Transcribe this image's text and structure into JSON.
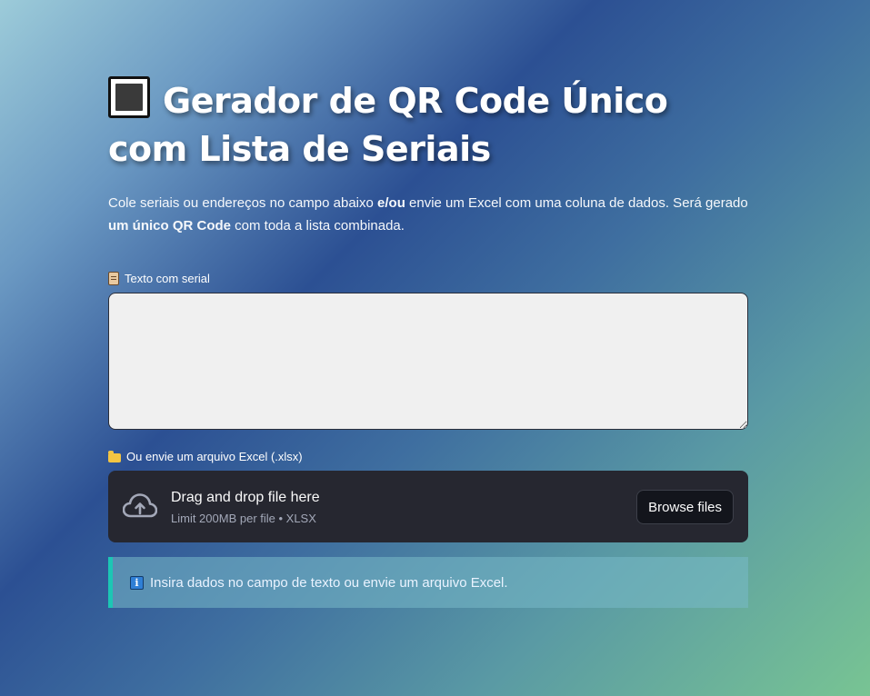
{
  "header": {
    "icon": "qr-code-icon",
    "title": "Gerador de QR Code Único com Lista de Seriais"
  },
  "description": {
    "part1": "Cole seriais ou endereços no campo abaixo ",
    "bold1": "e/ou",
    "part2": " envie um Excel com uma coluna de dados. Será gerado ",
    "bold2": "um único QR Code",
    "part3": " com toda a lista combinada."
  },
  "text_input": {
    "icon": "scroll-icon",
    "label": "Texto com serial",
    "value": "",
    "placeholder": ""
  },
  "file_input": {
    "icon": "folder-icon",
    "label": "Ou envie um arquivo Excel (.xlsx)",
    "dropzone_title": "Drag and drop file here",
    "dropzone_limit": "Limit 200MB per file • XLSX",
    "browse_button": "Browse files"
  },
  "info_box": {
    "icon": "info-icon",
    "icon_glyph": "i",
    "message": "Insira dados no campo de texto ou envie um arquivo Excel."
  },
  "colors": {
    "info_accent": "#1cc6b4",
    "dropzone_bg": "#262730",
    "textarea_bg": "#f0f0f0"
  }
}
